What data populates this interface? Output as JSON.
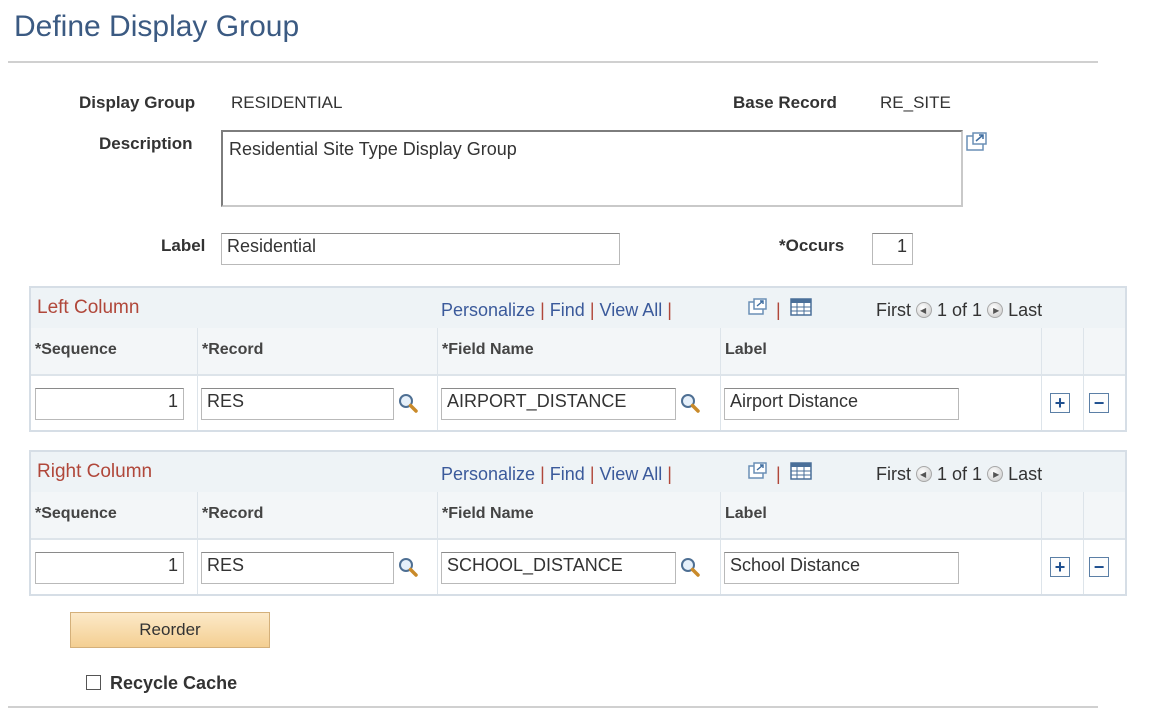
{
  "page": {
    "title": "Define Display Group"
  },
  "header": {
    "display_group_label": "Display Group",
    "display_group_value": "RESIDENTIAL",
    "base_record_label": "Base Record",
    "base_record_value": "RE_SITE",
    "description_label": "Description",
    "description_value": "Residential Site Type Display Group",
    "label_label": "Label",
    "label_value": "Residential",
    "occurs_label": "*Occurs",
    "occurs_value": "1"
  },
  "grid_nav": {
    "personalize": "Personalize",
    "sep": "|",
    "find": "Find",
    "view_all": "View All",
    "first": "First",
    "page": "1 of 1",
    "last": "Last"
  },
  "columns": {
    "sequence": "*Sequence",
    "record": "*Record",
    "field_name": "*Field Name",
    "label": "Label"
  },
  "left_column": {
    "title": "Left Column",
    "row": {
      "sequence": "1",
      "record": "RES",
      "field_name": "AIRPORT_DISTANCE",
      "label": "Airport Distance"
    }
  },
  "right_column": {
    "title": "Right Column",
    "row": {
      "sequence": "1",
      "record": "RES",
      "field_name": "SCHOOL_DISTANCE",
      "label": "School Distance"
    }
  },
  "buttons": {
    "reorder": "Reorder",
    "add": "+",
    "delete": "−"
  },
  "recycle_cache": {
    "label": "Recycle Cache",
    "checked": false
  },
  "icons": {
    "expand": "expand-icon",
    "lookup": "magnifier-icon",
    "grid": "grid-icon",
    "prev": "left-arrow-icon",
    "next": "right-arrow-icon"
  }
}
